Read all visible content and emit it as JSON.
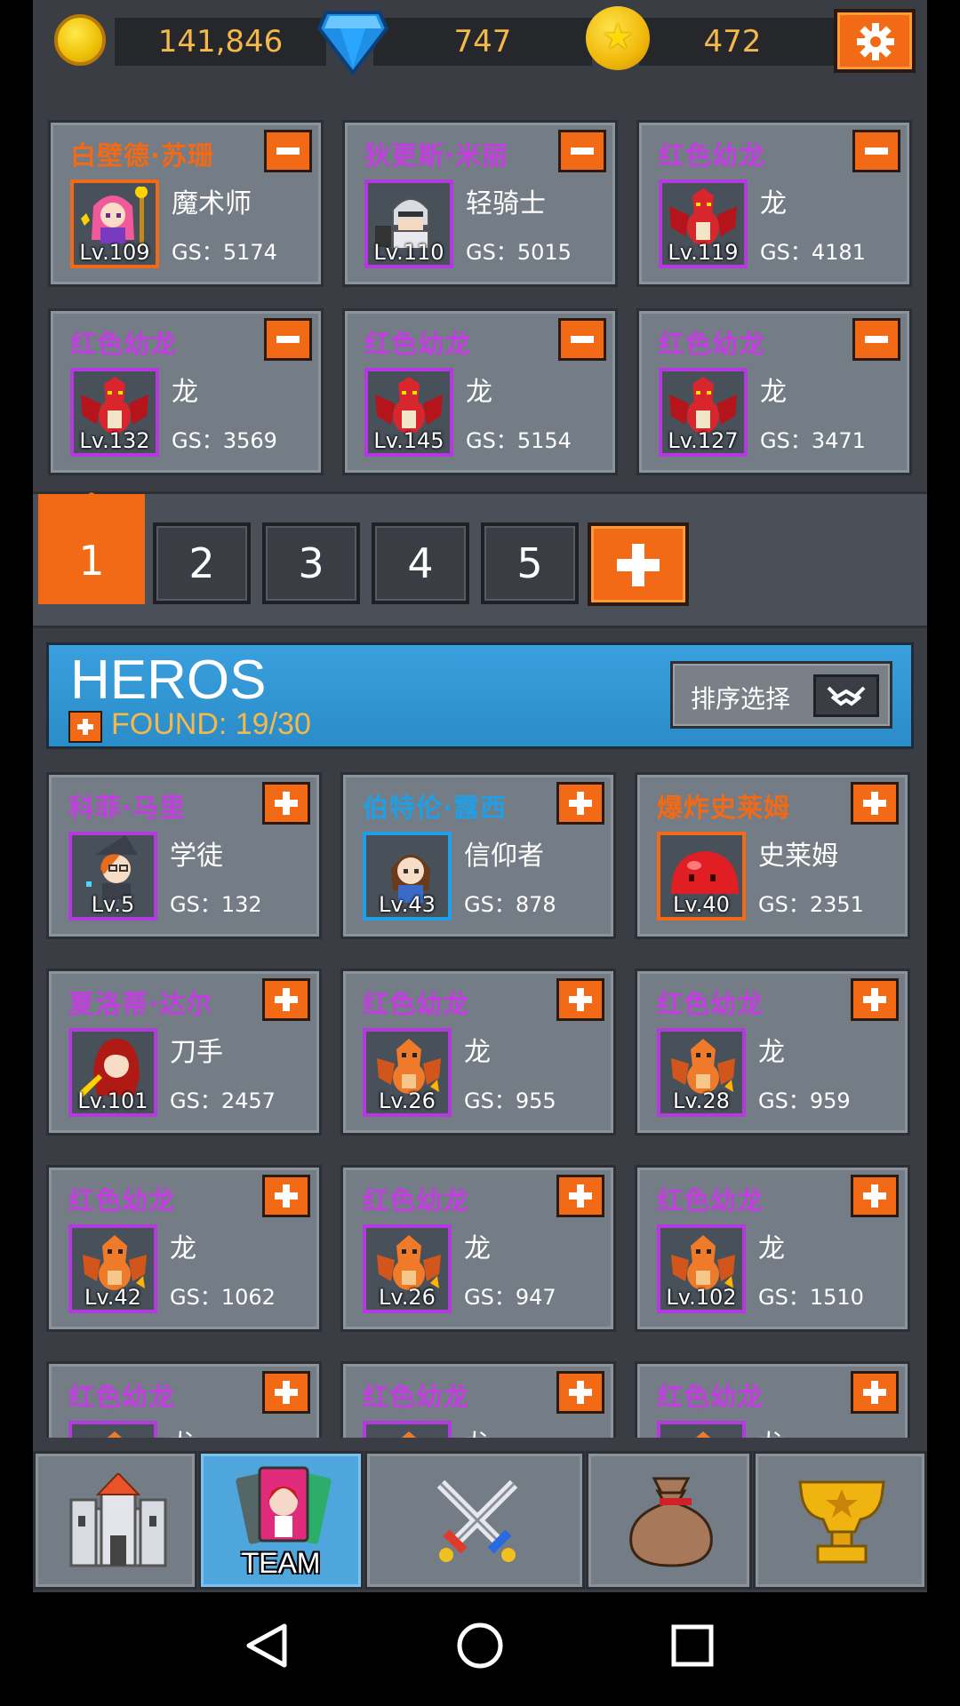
{
  "currency": {
    "gold": "141,846",
    "gems": "747",
    "stars": "472"
  },
  "team": [
    {
      "name": "白壁德·苏珊",
      "name_color": "#f26a16",
      "class": "魔术师",
      "level": "Lv.109",
      "gs": "GS：5174",
      "sprite": "mage-girl",
      "border": "gold"
    },
    {
      "name": "狄更斯·米丽",
      "name_color": "#c23ee0",
      "class": "轻骑士",
      "level": "Lv.110",
      "gs": "GS：5015",
      "sprite": "knight",
      "border": "purple"
    },
    {
      "name": "红色幼龙",
      "name_color": "#c23ee0",
      "class": "龙",
      "level": "Lv.119",
      "gs": "GS：4181",
      "sprite": "red-dragon",
      "border": "purple"
    },
    {
      "name": "红色幼龙",
      "name_color": "#c23ee0",
      "class": "龙",
      "level": "Lv.132",
      "gs": "GS：3569",
      "sprite": "red-dragon",
      "border": "purple"
    },
    {
      "name": "红色幼龙",
      "name_color": "#c23ee0",
      "class": "龙",
      "level": "Lv.145",
      "gs": "GS：5154",
      "sprite": "red-dragon",
      "border": "purple"
    },
    {
      "name": "红色幼龙",
      "name_color": "#c23ee0",
      "class": "龙",
      "level": "Lv.127",
      "gs": "GS：3471",
      "sprite": "red-dragon",
      "border": "purple"
    }
  ],
  "tabs": [
    "1",
    "2",
    "3",
    "4",
    "5"
  ],
  "active_tab": "1",
  "heros": {
    "title": "HEROS",
    "found": "FOUND: 19/30",
    "sort_label": "排序选择"
  },
  "heroes": [
    {
      "name": "科菲·马里",
      "name_color": "#c23ee0",
      "class": "学徒",
      "level": "Lv.5",
      "gs": "GS：132",
      "sprite": "apprentice",
      "border": "purple"
    },
    {
      "name": "伯特伦·露西",
      "name_color": "#1fa0e6",
      "class": "信仰者",
      "level": "Lv.43",
      "gs": "GS：878",
      "sprite": "believer",
      "border": "blue"
    },
    {
      "name": "爆炸史莱姆",
      "name_color": "#f26a16",
      "class": "史莱姆",
      "level": "Lv.40",
      "gs": "GS：2351",
      "sprite": "slime",
      "border": "orange"
    },
    {
      "name": "夏洛蒂·达尔",
      "name_color": "#c23ee0",
      "class": "刀手",
      "level": "Lv.101",
      "gs": "GS：2457",
      "sprite": "blade-girl",
      "border": "purple"
    },
    {
      "name": "红色幼龙",
      "name_color": "#c23ee0",
      "class": "龙",
      "level": "Lv.26",
      "gs": "GS：955",
      "sprite": "orange-dragon",
      "border": "purple"
    },
    {
      "name": "红色幼龙",
      "name_color": "#c23ee0",
      "class": "龙",
      "level": "Lv.28",
      "gs": "GS：959",
      "sprite": "orange-dragon",
      "border": "purple"
    },
    {
      "name": "红色幼龙",
      "name_color": "#c23ee0",
      "class": "龙",
      "level": "Lv.42",
      "gs": "GS：1062",
      "sprite": "orange-dragon",
      "border": "purple"
    },
    {
      "name": "红色幼龙",
      "name_color": "#c23ee0",
      "class": "龙",
      "level": "Lv.26",
      "gs": "GS：947",
      "sprite": "orange-dragon",
      "border": "purple"
    },
    {
      "name": "红色幼龙",
      "name_color": "#c23ee0",
      "class": "龙",
      "level": "Lv.102",
      "gs": "GS：1510",
      "sprite": "orange-dragon",
      "border": "purple"
    },
    {
      "name": "红色幼龙",
      "name_color": "#c23ee0",
      "class": "龙",
      "level": "",
      "gs": "",
      "sprite": "orange-dragon",
      "border": "purple"
    },
    {
      "name": "红色幼龙",
      "name_color": "#c23ee0",
      "class": "龙",
      "level": "",
      "gs": "",
      "sprite": "orange-dragon",
      "border": "purple"
    },
    {
      "name": "红色幼龙",
      "name_color": "#c23ee0",
      "class": "龙",
      "level": "",
      "gs": "",
      "sprite": "orange-dragon",
      "border": "purple"
    }
  ],
  "bottom_nav": [
    {
      "id": "castle",
      "icon": "castle-icon",
      "label": ""
    },
    {
      "id": "team",
      "icon": "team-card-icon",
      "label": "TEAM",
      "active": true
    },
    {
      "id": "battle",
      "icon": "crossed-swords-icon",
      "label": ""
    },
    {
      "id": "bag",
      "icon": "money-bag-icon",
      "label": ""
    },
    {
      "id": "trophy",
      "icon": "trophy-icon",
      "label": ""
    }
  ],
  "system_nav": [
    "back-icon",
    "home-icon",
    "recents-icon"
  ]
}
